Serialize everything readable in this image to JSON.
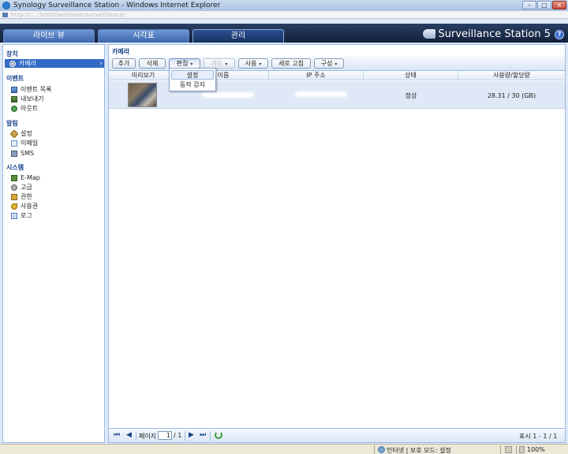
{
  "window": {
    "title": "Synology Surveillance Station - Windows Internet Explorer",
    "address_url": "http://...:5000/webman/surveillance/"
  },
  "tabs": [
    {
      "label": "라이브 뷰",
      "active": false
    },
    {
      "label": "시각표",
      "active": false
    },
    {
      "label": "관리",
      "active": true
    }
  ],
  "brand": {
    "name": "Surveillance Station 5",
    "help": "?"
  },
  "sidebar": {
    "sections": [
      {
        "title": "장치",
        "items": [
          "카메라"
        ]
      },
      {
        "title": "이벤트",
        "items": [
          "이벤트 목록",
          "내보내기",
          "아웃트"
        ]
      },
      {
        "title": "알림",
        "items": [
          "설정",
          "이메일",
          "SMS"
        ]
      },
      {
        "title": "시스템",
        "items": [
          "E-Map",
          "고급",
          "권한",
          "사용권",
          "로그"
        ]
      }
    ],
    "selected": "카메라",
    "selected_arrow": "›"
  },
  "panel": {
    "title": "카메라"
  },
  "toolbar": {
    "add": "추가",
    "delete": "삭제",
    "edit": "편집",
    "guide": "가드",
    "use": "사용",
    "refresh": "새로 고침",
    "config": "구성",
    "caret": "▾"
  },
  "edit_menu": {
    "items": [
      "설정",
      "동작 감지"
    ]
  },
  "grid": {
    "columns": [
      "미리보기",
      "이름",
      "IP 주소",
      "상태",
      "사용량/할당량"
    ],
    "rows": [
      {
        "status": "정상",
        "usage": "28.31 / 30 (GB)"
      }
    ]
  },
  "pager": {
    "first": "⏮",
    "prev": "◀",
    "page_label": "페이지",
    "page_value": "1",
    "of_total": "/ 1",
    "next": "▶",
    "last": "⏭",
    "display": "표시 1 - 1 / 1"
  },
  "statusbar": {
    "zone": "인터넷 | 보호 모드: 설정",
    "zoom": "100%"
  },
  "colors": {
    "header": "#1f3253",
    "accent": "#316ac5",
    "row_selected": "#dfe8f6"
  }
}
